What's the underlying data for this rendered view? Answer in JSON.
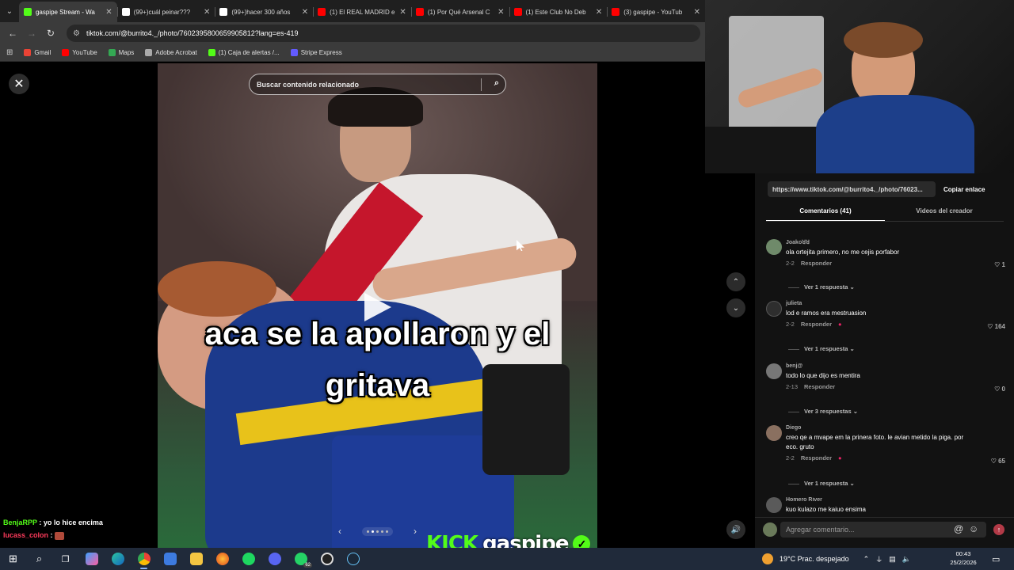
{
  "browser": {
    "tabs": [
      {
        "title": "gaspipe Stream - Wa",
        "color": "#53fc18",
        "active": true
      },
      {
        "title": "(99+)cuál peinar???",
        "color": "#ffffff",
        "active": false
      },
      {
        "title": "(99+)hacer 300 años",
        "color": "#ffffff",
        "active": false
      },
      {
        "title": "(1) El REAL MADRID e",
        "color": "#ff0000",
        "active": false
      },
      {
        "title": "(1) Por Qué Arsenal C",
        "color": "#ff0000",
        "active": false
      },
      {
        "title": "(1) Este Club No Deb",
        "color": "#ff0000",
        "active": false
      },
      {
        "title": "(3) gaspipe - YouTub",
        "color": "#ff0000",
        "active": false
      }
    ],
    "url": "tiktok.com/@burrito4._/photo/7602395800659905812?lang=es-419",
    "bookmarks": [
      {
        "label": "Gmail",
        "color": "#ea4335"
      },
      {
        "label": "YouTube",
        "color": "#ff0000"
      },
      {
        "label": "Maps",
        "color": "#34a853"
      },
      {
        "label": "Adobe Acrobat",
        "color": "#aaaaaa"
      },
      {
        "label": "(1) Caja de alertas /...",
        "color": "#53fc18"
      },
      {
        "label": "Stripe Express",
        "color": "#635bff"
      }
    ]
  },
  "viewer": {
    "search_placeholder": "Buscar contenido relacionado",
    "caption_line1": "aca se la apollaron y el",
    "caption_line2": "gritava"
  },
  "stream": {
    "brand": "KICK",
    "channel": "gaspipe",
    "chat": [
      {
        "user": "BenjaRPP",
        "message": "yo lo hice encima"
      },
      {
        "user": "lucass_colon",
        "message": ""
      }
    ]
  },
  "panel": {
    "link_url": "https://www.tiktok.com/@burrito4._/photo/76023...",
    "copy_label": "Copiar enlace",
    "tab_comments": "Comentarios (41)",
    "tab_videos": "Videos del creador",
    "reply_label": "Responder",
    "comments": [
      {
        "user": "Joakoꓤꓤ",
        "text": "ola ortejita primero, no me cejis porfabor",
        "date": "2-2",
        "likes": "1",
        "more": "Ver 1 respuesta",
        "avatar": "#6f8a6a"
      },
      {
        "user": "julieta",
        "text": "lod e ramos era mestruasion",
        "date": "2-2",
        "likes": "164",
        "more": "Ver 1 respuesta",
        "avatar": "#2e2e2e"
      },
      {
        "user": "benj@",
        "text": "todo lo que dijo es mentira",
        "date": "2-13",
        "likes": "0",
        "more": "Ver 3 respuestas",
        "avatar": "#777777"
      },
      {
        "user": "Diego",
        "text": "creo qe a mvape em la prinera foto. le avian metido la piga. por eco. gruto",
        "date": "2-2",
        "likes": "65",
        "more": "Ver 1 respuesta",
        "avatar": "#8a7060"
      },
      {
        "user": "Homero River",
        "text": "kuo kulazo me kaiuo ensima",
        "date": "",
        "likes": "",
        "more": "",
        "avatar": "#5a5a5a"
      }
    ],
    "add_comment_placeholder": "Agregar comentario..."
  },
  "taskbar": {
    "weather": "19°C  Prac. despejado",
    "time": "00:43",
    "date": "25/2/2026",
    "whatsapp_badge": "62"
  },
  "colors": {
    "kick_green": "#53fc18",
    "tiktok_red": "#fe2c55"
  }
}
